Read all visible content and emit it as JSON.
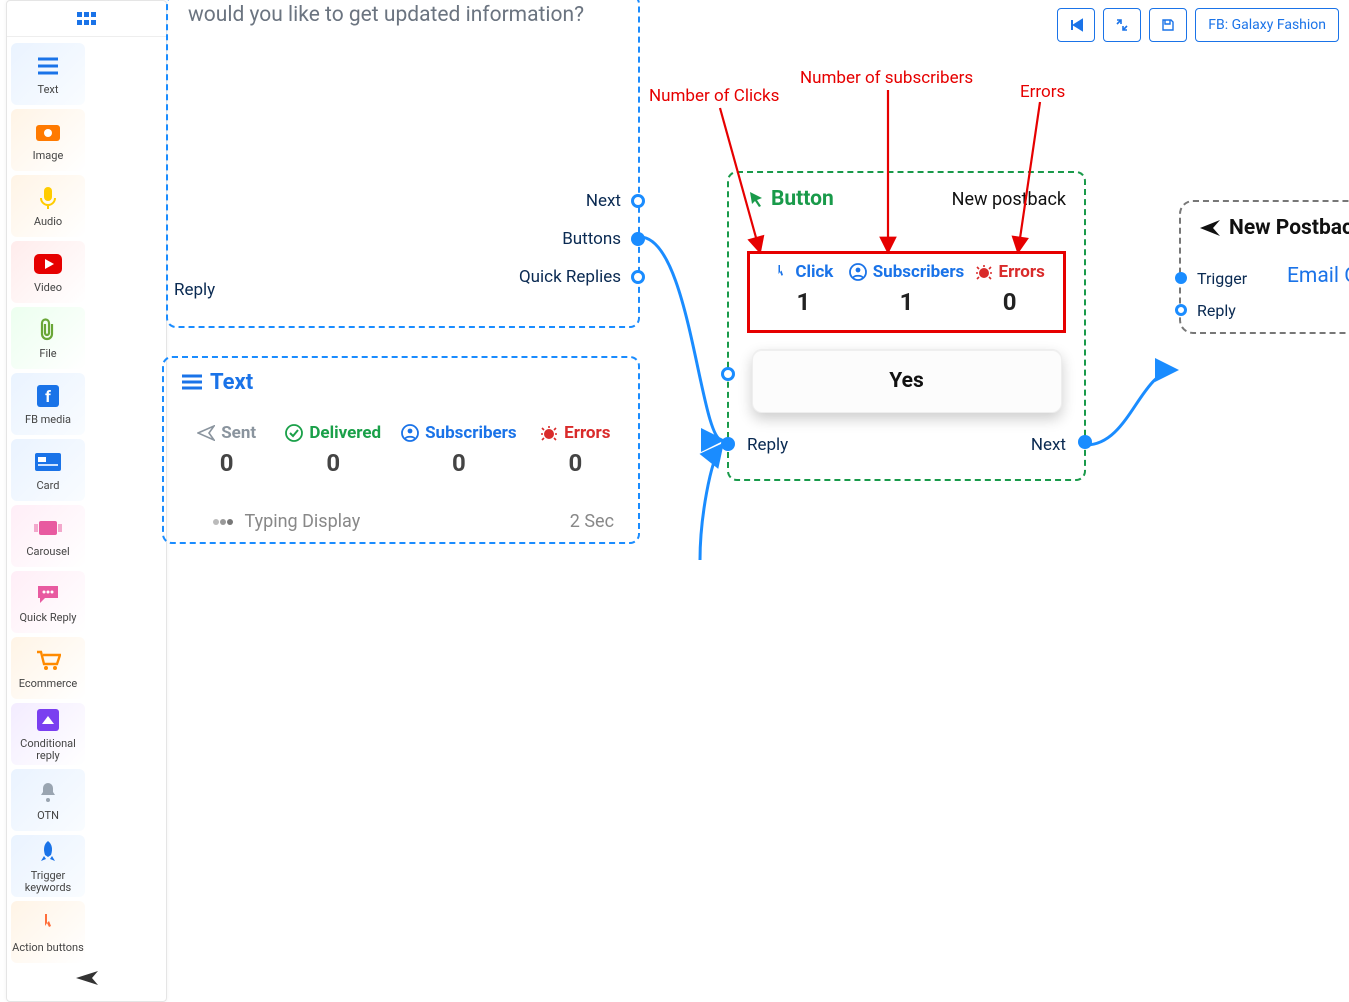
{
  "toolbar": {
    "rewind": "⏮",
    "collapse": "⇲",
    "save": "💾",
    "channel": "FB: Galaxy Fashion"
  },
  "palette": {
    "items": [
      {
        "label": "Text",
        "style": "pal-blue",
        "icon": "text-lines"
      },
      {
        "label": "Image",
        "style": "pal-orange",
        "icon": "camera"
      },
      {
        "label": "Audio",
        "style": "pal-orange",
        "icon": "mic"
      },
      {
        "label": "Video",
        "style": "pal-red",
        "icon": "youtube"
      },
      {
        "label": "File",
        "style": "pal-green",
        "icon": "clip"
      },
      {
        "label": "FB media",
        "style": "pal-blue",
        "icon": "fb"
      },
      {
        "label": "Card",
        "style": "pal-blue",
        "icon": "card"
      },
      {
        "label": "Carousel",
        "style": "pal-pink",
        "icon": "carousel"
      },
      {
        "label": "Quick Reply",
        "style": "pal-pink",
        "icon": "chat"
      },
      {
        "label": "Ecommerce",
        "style": "pal-orange",
        "icon": "cart"
      },
      {
        "label": "Conditional reply",
        "style": "pal-purple",
        "icon": "cond"
      },
      {
        "label": "OTN",
        "style": "pal-blue",
        "icon": "bell"
      },
      {
        "label": "Trigger keywords",
        "style": "pal-blue",
        "icon": "rocket"
      },
      {
        "label": "Action buttons",
        "style": "pal-orange",
        "icon": "pointer"
      }
    ]
  },
  "node_msg": {
    "text": "would you like to get updated information?",
    "ports": {
      "next": "Next",
      "buttons": "Buttons",
      "quick": "Quick Replies"
    },
    "reply": "Reply"
  },
  "node_text": {
    "title": "Text",
    "stats": [
      {
        "label": "Sent",
        "value": "0",
        "color": "#8a949e",
        "icon": "send"
      },
      {
        "label": "Delivered",
        "value": "0",
        "color": "#1aa049",
        "icon": "check"
      },
      {
        "label": "Subscribers",
        "value": "0",
        "color": "#1a73e8",
        "icon": "user"
      },
      {
        "label": "Errors",
        "value": "0",
        "color": "#d92b2b",
        "icon": "bug"
      }
    ],
    "typing_label": "Typing Display",
    "typing_value": "2 Sec"
  },
  "node_button": {
    "title": "Button",
    "subtitle": "New postback",
    "stats": [
      {
        "label": "Click",
        "value": "1",
        "color": "#1a73e8",
        "icon": "pointer2"
      },
      {
        "label": "Subscribers",
        "value": "1",
        "color": "#1a73e8",
        "icon": "user"
      },
      {
        "label": "Errors",
        "value": "0",
        "color": "#d92b2b",
        "icon": "bug"
      }
    ],
    "button_label": "Yes",
    "reply": "Reply",
    "next": "Next"
  },
  "node_postback": {
    "title": "New Postback",
    "link": "Email Co",
    "trigger": "Trigger",
    "reply": "Reply"
  },
  "annotations": {
    "clicks": "Number of Clicks",
    "subs": "Number of subscribers",
    "errors": "Errors"
  }
}
